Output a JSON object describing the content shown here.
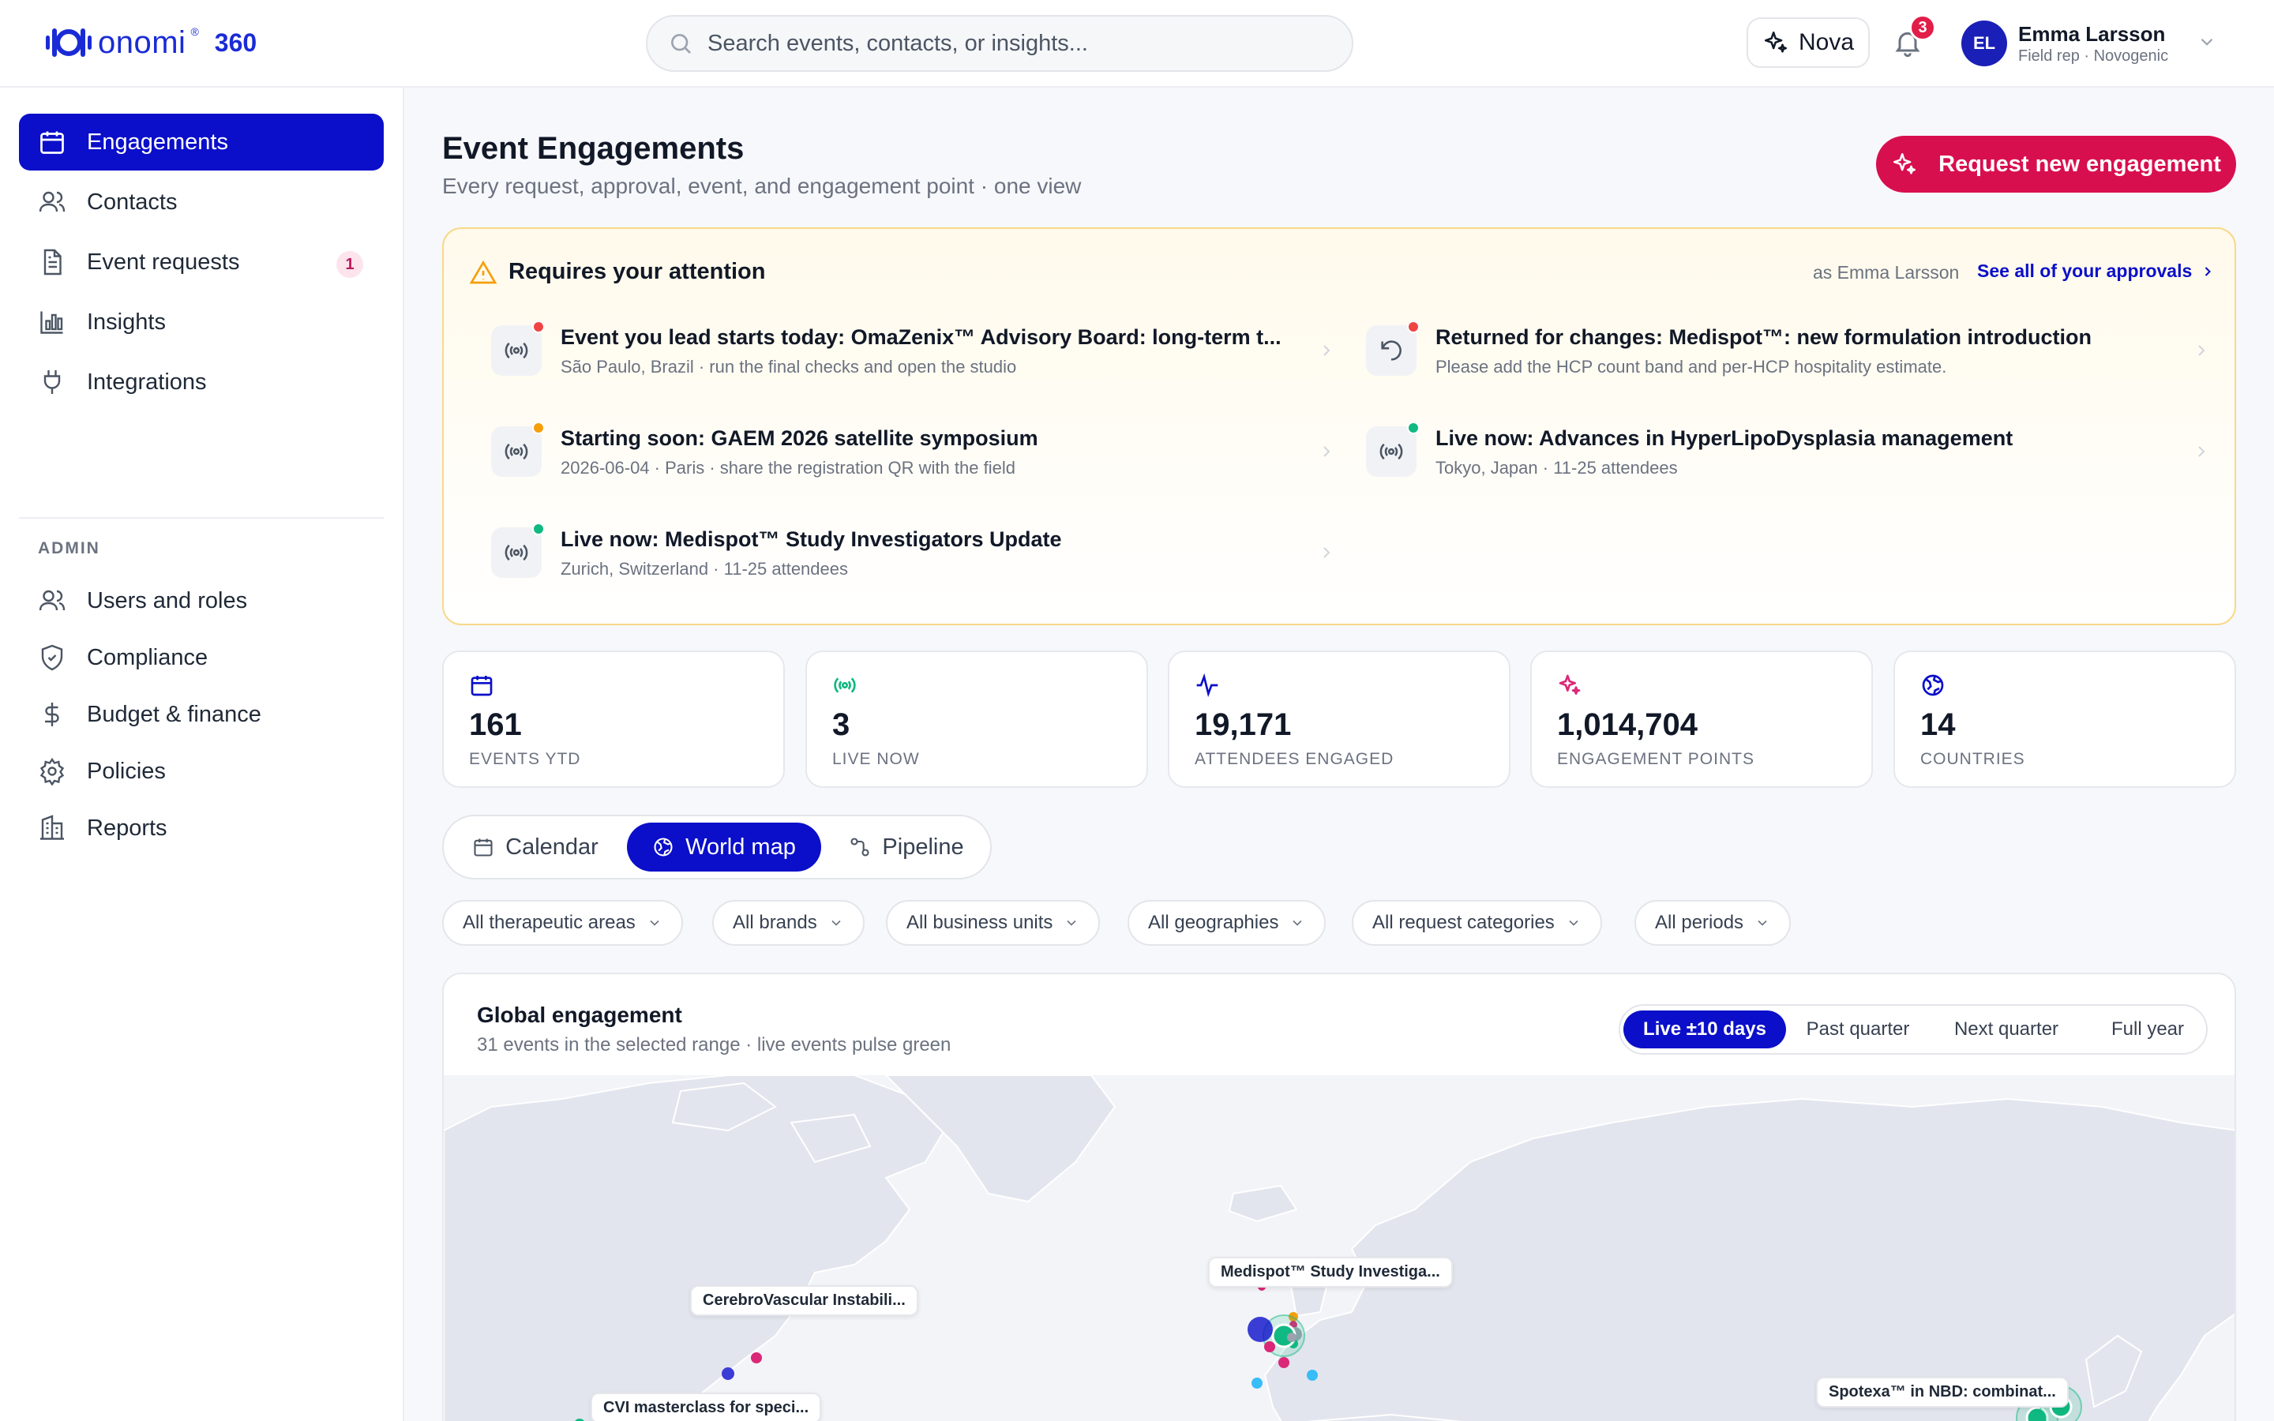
{
  "app": {
    "logo_word": "onomi",
    "logo_reg": "®",
    "logo_suffix": "360"
  },
  "search": {
    "placeholder": "Search events, contacts, or insights..."
  },
  "header": {
    "nova_label": "Nova",
    "notifications_count": "3",
    "user_initials": "EL",
    "user_name": "Emma Larsson",
    "user_role": "Field rep · Novogenic"
  },
  "sidebar": {
    "items": [
      {
        "label": "Engagements",
        "icon": "calendar-icon",
        "active": true
      },
      {
        "label": "Contacts",
        "icon": "users-icon"
      },
      {
        "label": "Event requests",
        "icon": "document-icon",
        "badge": "1"
      },
      {
        "label": "Insights",
        "icon": "bar-chart-icon"
      },
      {
        "label": "Integrations",
        "icon": "plug-icon"
      }
    ],
    "admin_heading": "ADMIN",
    "admin_items": [
      {
        "label": "Users and roles",
        "icon": "users-icon"
      },
      {
        "label": "Compliance",
        "icon": "shield-icon"
      },
      {
        "label": "Budget & finance",
        "icon": "dollar-icon"
      },
      {
        "label": "Policies",
        "icon": "gear-icon"
      },
      {
        "label": "Reports",
        "icon": "building-icon"
      }
    ]
  },
  "page": {
    "title": "Event Engagements",
    "subtitle": "Every request, approval, event, and engagement point · one view",
    "primary_action": "Request new engagement"
  },
  "attention": {
    "title": "Requires your attention",
    "as_user": "as Emma Larsson",
    "see_all": "See all of your approvals",
    "items": [
      {
        "title": "Event you lead starts today: OmaZenix™ Advisory Board: long-term t...",
        "subtitle": "São Paulo, Brazil · run the final checks and open the studio",
        "icon": "broadcast-icon",
        "dot_color": "#ef4444"
      },
      {
        "title": "Returned for changes: Medispot™: new formulation introduction",
        "subtitle": "Please add the HCP count band and per-HCP hospitality estimate.",
        "icon": "undo-icon",
        "dot_color": "#ef4444"
      },
      {
        "title": "Starting soon: GAEM 2026 satellite symposium",
        "subtitle": "2026-06-04 · Paris · share the registration QR with the field",
        "icon": "broadcast-icon",
        "dot_color": "#f59e0b"
      },
      {
        "title": "Live now: Advances in HyperLipoDysplasia management",
        "subtitle": "Tokyo, Japan · 11-25 attendees",
        "icon": "broadcast-icon",
        "dot_color": "#10b981"
      },
      {
        "title": "Live now: Medispot™ Study Investigators Update",
        "subtitle": "Zurich, Switzerland · 11-25 attendees",
        "icon": "broadcast-icon",
        "dot_color": "#10b981"
      }
    ]
  },
  "kpis": [
    {
      "value": "161",
      "label": "EVENTS YTD",
      "icon": "calendar-icon",
      "color": "#0b0fc9"
    },
    {
      "value": "3",
      "label": "LIVE NOW",
      "icon": "broadcast-icon",
      "color": "#10b981"
    },
    {
      "value": "19,171",
      "label": "ATTENDEES ENGAGED",
      "icon": "activity-icon",
      "color": "#0b0fc9"
    },
    {
      "value": "1,014,704",
      "label": "ENGAGEMENT POINTS",
      "icon": "sparkle-icon",
      "color": "#db2777"
    },
    {
      "value": "14",
      "label": "COUNTRIES",
      "icon": "globe-icon",
      "color": "#0b0fc9"
    }
  ],
  "view_tabs": [
    {
      "label": "Calendar",
      "icon": "calendar-icon"
    },
    {
      "label": "World map",
      "icon": "globe-icon",
      "active": true
    },
    {
      "label": "Pipeline",
      "icon": "pipeline-icon"
    }
  ],
  "filters": [
    "All therapeutic areas",
    "All brands",
    "All business units",
    "All geographies",
    "All request categories",
    "All periods"
  ],
  "map": {
    "title": "Global engagement",
    "subtitle": "31 events in the selected range · live events pulse green",
    "ranges": [
      {
        "label": "Live ±10 days",
        "active": true
      },
      {
        "label": "Past quarter"
      },
      {
        "label": "Next quarter"
      },
      {
        "label": "Full year"
      }
    ],
    "labels": [
      "Medispot™ Study Investiga...",
      "CerebroVascular Instabili...",
      "CVI masterclass for speci...",
      "Spotexa™ in NBD: combinat..."
    ],
    "colors": {
      "live": "#10b981",
      "primary": "#0b0fc9",
      "pink": "#db2777",
      "land": "#e5e7ef"
    }
  }
}
